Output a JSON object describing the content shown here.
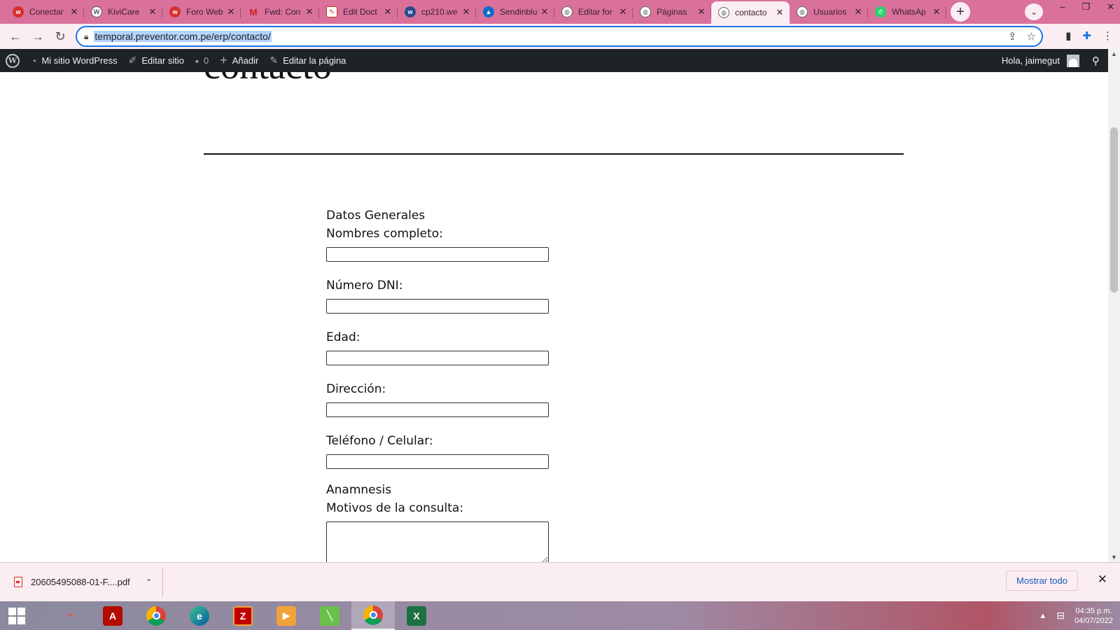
{
  "browser": {
    "tabs": [
      {
        "label": "Conectar",
        "icon": "w-red-icon",
        "color": "#d62f2f"
      },
      {
        "label": "KiviCare",
        "icon": "wordpress-icon",
        "color": "#555555"
      },
      {
        "label": "Foro Web",
        "icon": "w-red-icon",
        "color": "#d62f2f"
      },
      {
        "label": "Fwd: Con",
        "icon": "gmail-icon",
        "color": "#c5221f"
      },
      {
        "label": "Edit Doct",
        "icon": "doc-edit-icon",
        "color": "#d93025"
      },
      {
        "label": "cp210.we",
        "icon": "w-blue-icon",
        "color": "#2b4a8b"
      },
      {
        "label": "Sendinblu",
        "icon": "sendinblue-icon",
        "color": "#0b6bcb"
      },
      {
        "label": "Editar for",
        "icon": "globe-icon",
        "color": "#666666"
      },
      {
        "label": "Páginas",
        "icon": "globe-icon",
        "color": "#666666"
      },
      {
        "label": "contacto",
        "icon": "globe-icon",
        "color": "#666666",
        "active": true
      },
      {
        "label": "Usuarios",
        "icon": "globe-icon",
        "color": "#666666"
      },
      {
        "label": "WhatsAp",
        "icon": "whatsapp-icon",
        "color": "#25d366"
      }
    ],
    "url": "temporal.preventor.com.pe/erp/contacto/"
  },
  "adminbar": {
    "site_name": "Mi sitio WordPress",
    "edit_site": "Editar sitio",
    "comments_count": "0",
    "add_new": "Añadir",
    "edit_page": "Editar la página",
    "greeting": "Hola, jaimegut"
  },
  "page": {
    "title": "contacto",
    "section_general": "Datos Generales",
    "fields": [
      {
        "label": "Nombres completo:",
        "value": ""
      },
      {
        "label": "Número DNI:",
        "value": ""
      },
      {
        "label": "Edad:",
        "value": ""
      },
      {
        "label": "Dirección:",
        "value": ""
      },
      {
        "label": "Teléfono / Celular:",
        "value": ""
      }
    ],
    "section_anamnesis": "Anamnesis",
    "motivos_label": "Motivos de la consulta:",
    "motivos_value": ""
  },
  "downloads": {
    "file": "20605495088-01-F....pdf",
    "show_all": "Mostrar todo"
  },
  "taskbar": {
    "time": "04:35 p.m.",
    "date": "04/07/2022"
  }
}
